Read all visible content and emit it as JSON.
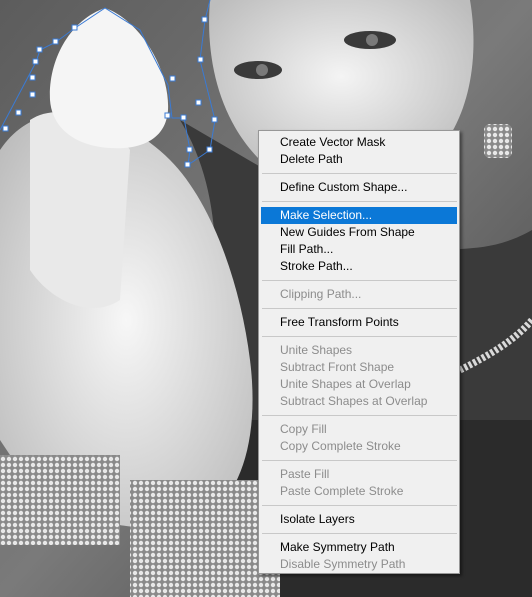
{
  "canvas": {
    "description_icon": "photo-canvas",
    "path_color": "#3a7bd5"
  },
  "context_menu": {
    "highlight_color": "#0b78d7",
    "groups": [
      {
        "items": [
          {
            "label": "Create Vector Mask",
            "enabled": true
          },
          {
            "label": "Delete Path",
            "enabled": true
          }
        ]
      },
      {
        "items": [
          {
            "label": "Define Custom Shape...",
            "enabled": true
          }
        ]
      },
      {
        "items": [
          {
            "label": "Make Selection...",
            "enabled": true,
            "highlighted": true
          },
          {
            "label": "New Guides From Shape",
            "enabled": true
          },
          {
            "label": "Fill Path...",
            "enabled": true
          },
          {
            "label": "Stroke Path...",
            "enabled": true
          }
        ]
      },
      {
        "items": [
          {
            "label": "Clipping Path...",
            "enabled": false
          }
        ]
      },
      {
        "items": [
          {
            "label": "Free Transform Points",
            "enabled": true
          }
        ]
      },
      {
        "items": [
          {
            "label": "Unite Shapes",
            "enabled": false
          },
          {
            "label": "Subtract Front Shape",
            "enabled": false
          },
          {
            "label": "Unite Shapes at Overlap",
            "enabled": false
          },
          {
            "label": "Subtract Shapes at Overlap",
            "enabled": false
          }
        ]
      },
      {
        "items": [
          {
            "label": "Copy Fill",
            "enabled": false
          },
          {
            "label": "Copy Complete Stroke",
            "enabled": false
          }
        ]
      },
      {
        "items": [
          {
            "label": "Paste Fill",
            "enabled": false
          },
          {
            "label": "Paste Complete Stroke",
            "enabled": false
          }
        ]
      },
      {
        "items": [
          {
            "label": "Isolate Layers",
            "enabled": true
          }
        ]
      },
      {
        "items": [
          {
            "label": "Make Symmetry Path",
            "enabled": true
          },
          {
            "label": "Disable Symmetry Path",
            "enabled": false
          }
        ]
      }
    ]
  }
}
